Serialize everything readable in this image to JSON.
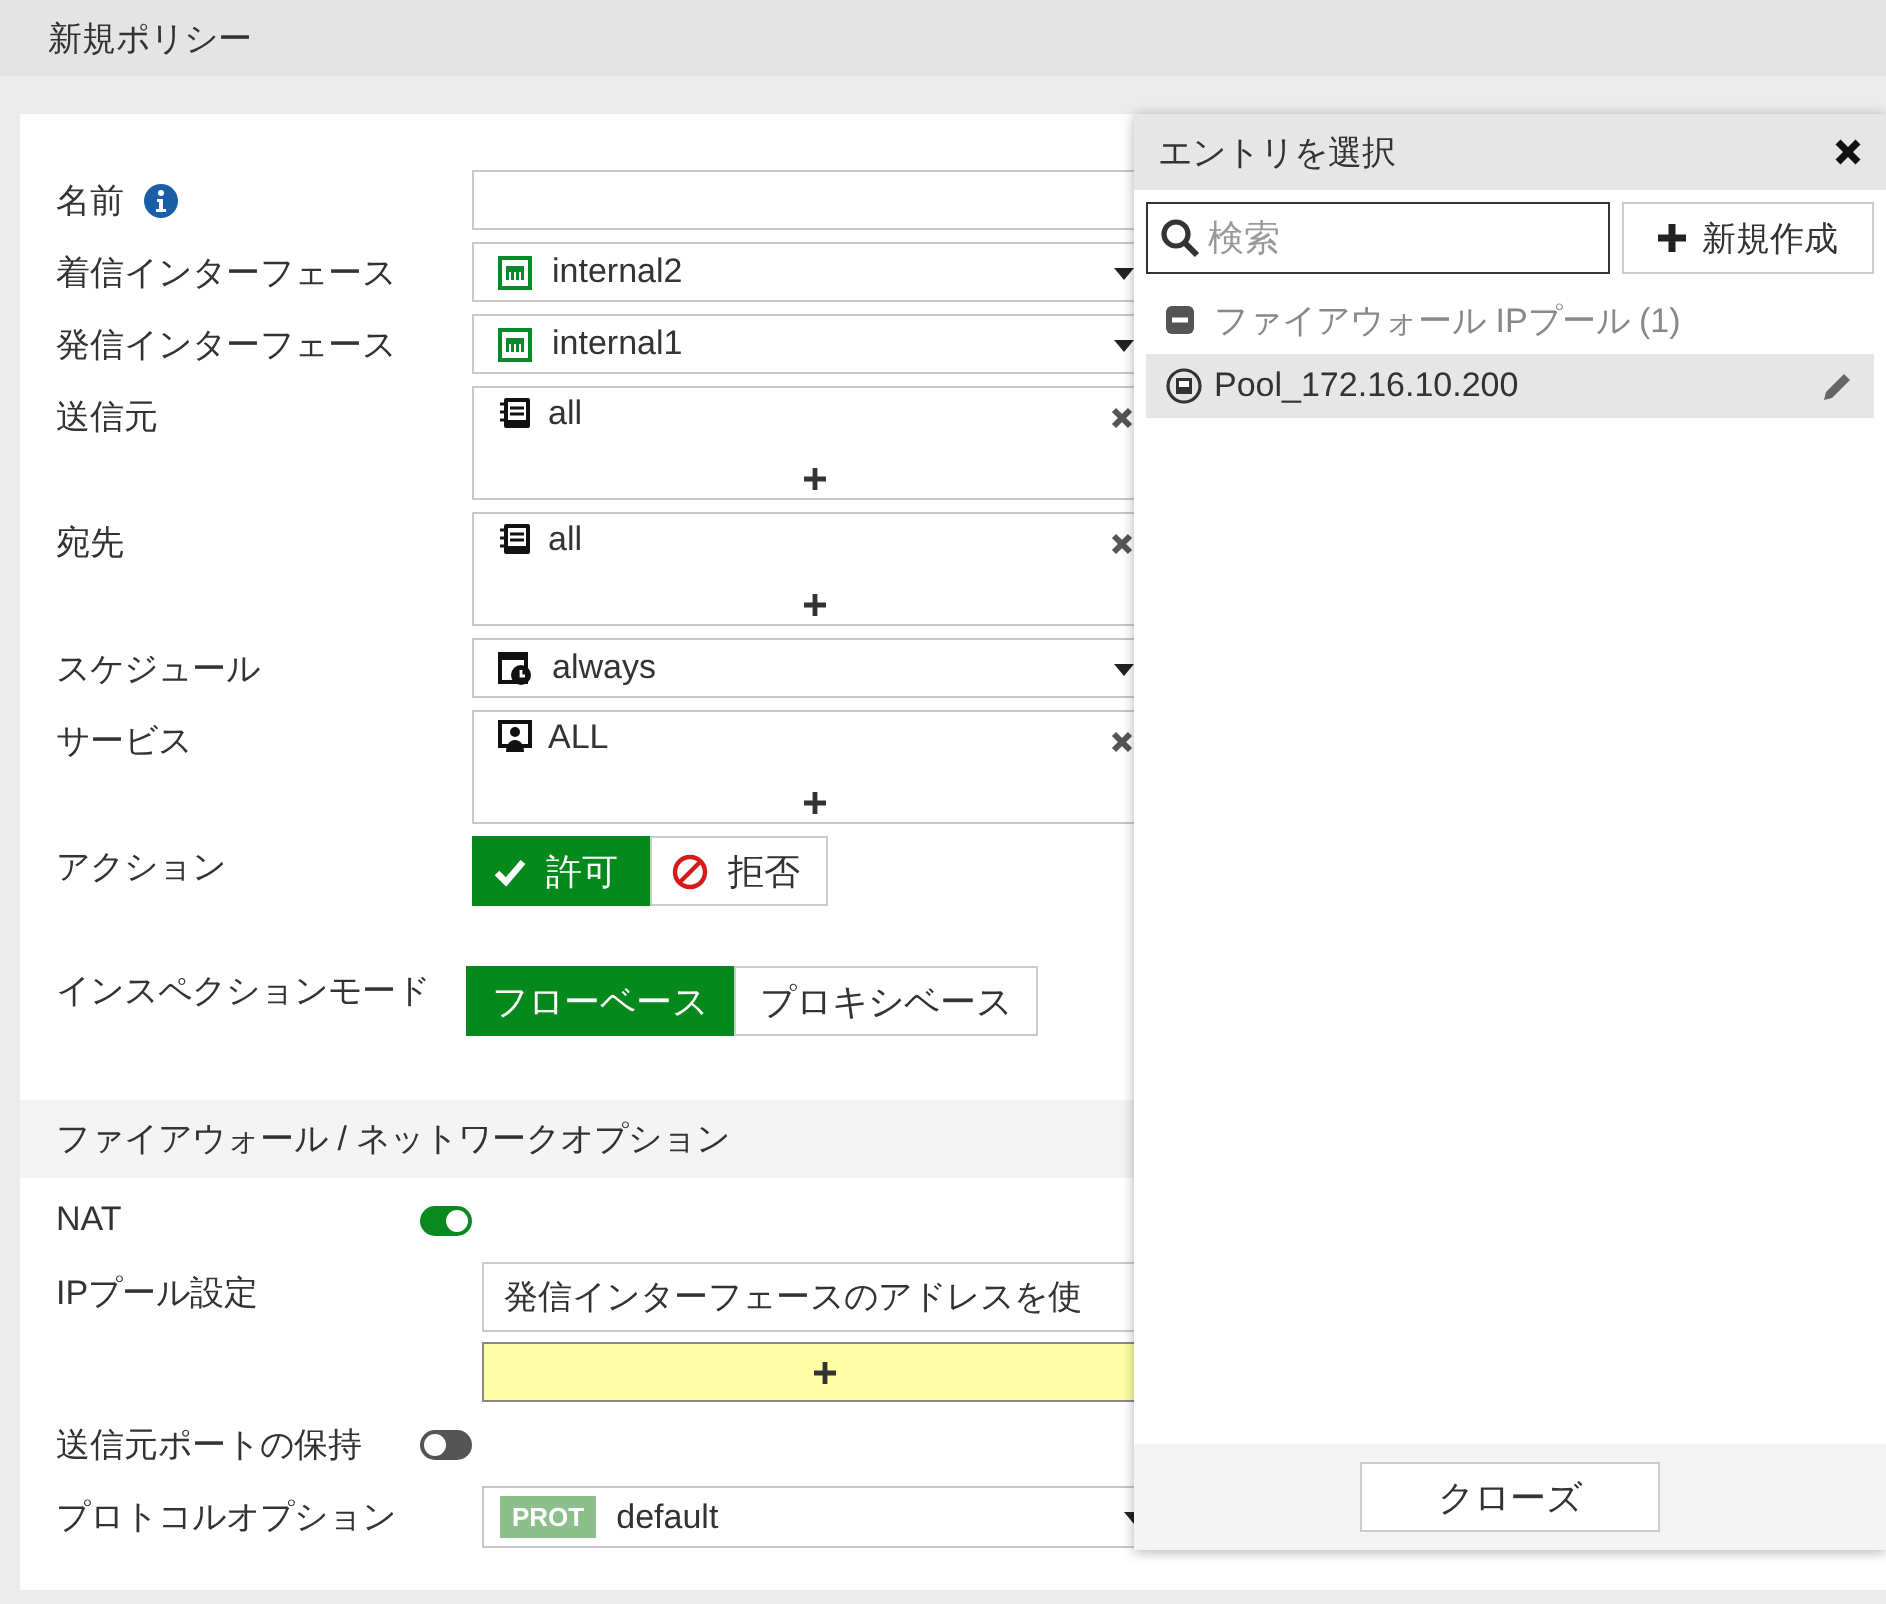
{
  "title": "新規ポリシー",
  "fields": [
    {
      "kind": "text",
      "label": "名前",
      "info": true
    },
    {
      "kind": "interface",
      "label": "着信インターフェース",
      "value": "internal2"
    },
    {
      "kind": "interface",
      "label": "発信インターフェース",
      "value": "internal1"
    },
    {
      "kind": "address",
      "label": "送信元",
      "values": [
        "all"
      ]
    },
    {
      "kind": "address",
      "label": "宛先",
      "values": [
        "all"
      ]
    },
    {
      "kind": "schedule",
      "label": "スケジュール",
      "value": "always"
    },
    {
      "kind": "service",
      "label": "サービス",
      "values": [
        "ALL"
      ]
    },
    {
      "kind": "action",
      "label": "アクション",
      "options": [
        {
          "label": "許可",
          "selected": true
        },
        {
          "label": "拒否",
          "selected": false
        }
      ]
    },
    {
      "kind": "mode",
      "label": "インスペクションモード",
      "options": [
        {
          "label": "フローベース",
          "selected": true
        },
        {
          "label": "プロキシベース",
          "selected": false
        }
      ]
    }
  ],
  "section": {
    "title": "ファイアウォール / ネットワークオプション",
    "fields": [
      {
        "kind": "toggle",
        "label": "NAT",
        "on": true
      },
      {
        "kind": "pool",
        "label": "IPプール設定",
        "value": "発信インターフェースのアドレスを使"
      },
      {
        "kind": "toggle",
        "label": "送信元ポートの保持",
        "on": false
      },
      {
        "kind": "protocol",
        "label": "プロトコルオプション",
        "badge": "PROT",
        "value": "default"
      }
    ]
  },
  "picker": {
    "title": "エントリを選択",
    "search": {
      "placeholder": "検索"
    },
    "new_button": "新規作成",
    "groups": [
      {
        "label": "ファイアウォール IPプール (1)",
        "expanded": true,
        "items": [
          {
            "label": "Pool_172.16.10.200",
            "selected": true
          }
        ]
      }
    ],
    "close_button": "クローズ"
  }
}
